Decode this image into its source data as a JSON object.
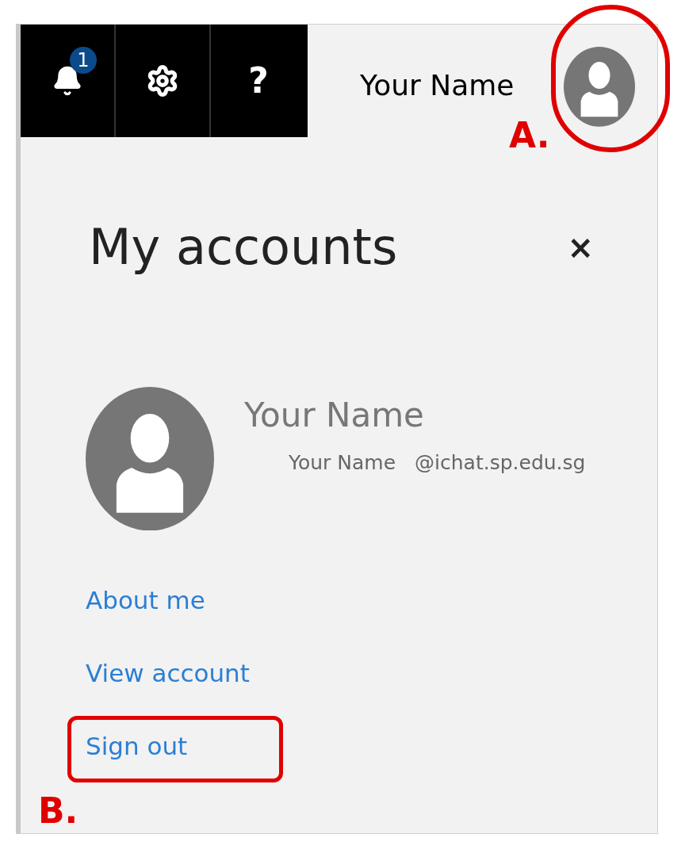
{
  "top_bar": {
    "notification_count": "1",
    "help": "?",
    "user_name": "Your Name"
  },
  "panel": {
    "title": "My accounts",
    "close": "×",
    "account": {
      "display_name": "Your Name",
      "user": "Your Name",
      "domain": "@ichat.sp.edu.sg"
    },
    "links": [
      {
        "label": "About me"
      },
      {
        "label": "View account"
      },
      {
        "label": "Sign out"
      }
    ]
  },
  "annotations": [
    {
      "label": "A."
    },
    {
      "label": "B."
    }
  ]
}
